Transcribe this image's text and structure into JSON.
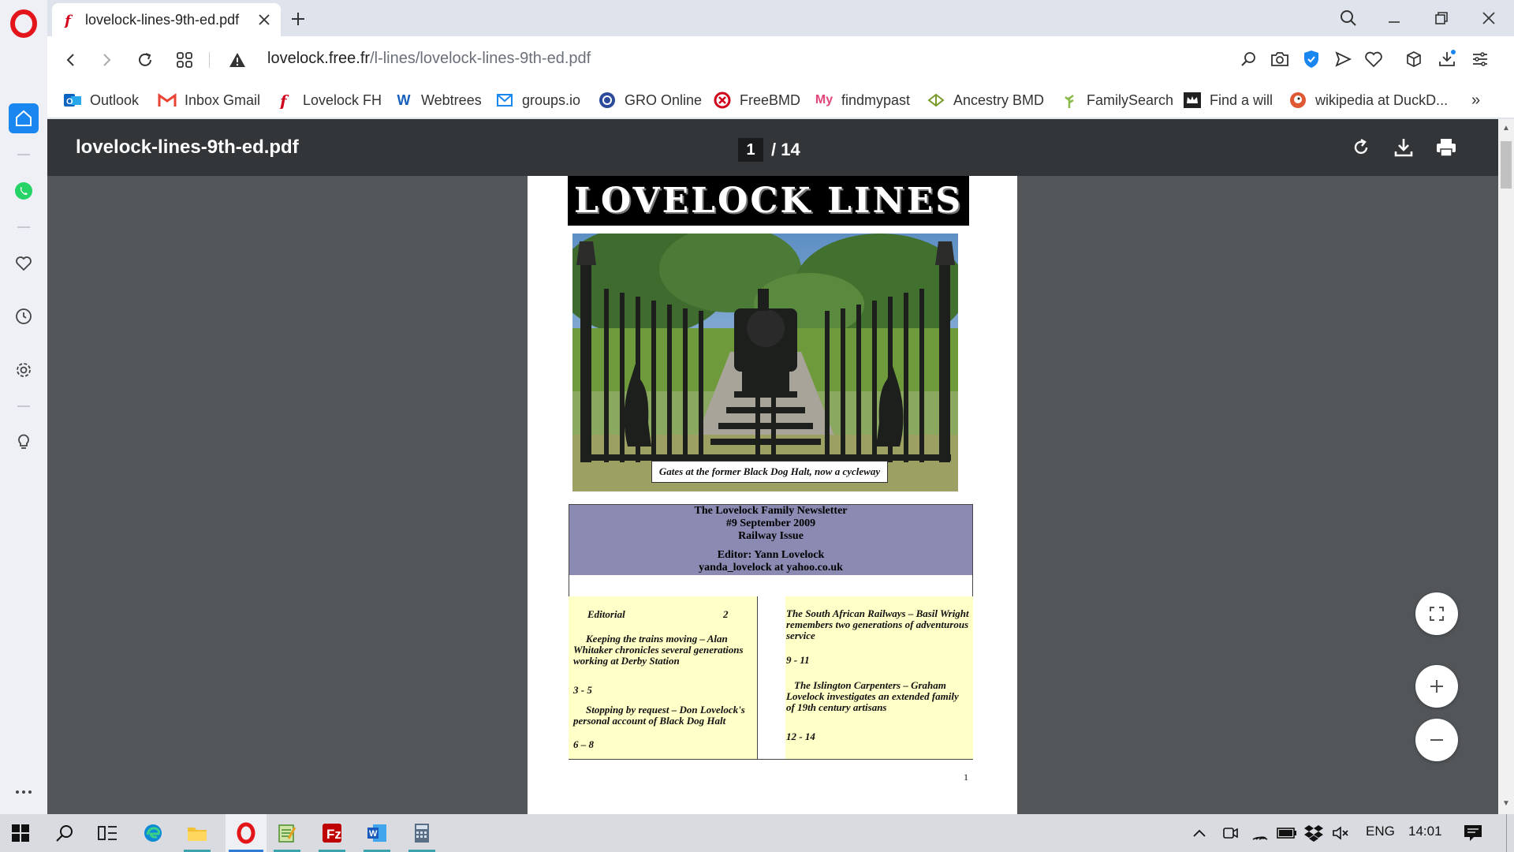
{
  "browser": {
    "tab": {
      "title": "lovelock-lines-9th-ed.pdf",
      "favicon": "free-fr-favicon"
    },
    "address": {
      "host": "lovelock.free.fr",
      "path": "/l-lines/lovelock-lines-9th-ed.pdf",
      "security": "warning-icon"
    },
    "bookmarks": [
      {
        "label": "Outlook",
        "icon": "outlook-icon"
      },
      {
        "label": "Inbox Gmail",
        "icon": "gmail-icon"
      },
      {
        "label": "Lovelock FH",
        "icon": "free-fr-favicon"
      },
      {
        "label": "Webtrees",
        "icon": "webtrees-icon"
      },
      {
        "label": "groups.io",
        "icon": "mail-icon"
      },
      {
        "label": "GRO Online",
        "icon": "gro-icon"
      },
      {
        "label": "FreeBMD",
        "icon": "freebmd-icon"
      },
      {
        "label": "findmypast",
        "icon": "findmypast-icon"
      },
      {
        "label": "Ancestry BMD",
        "icon": "ancestry-icon"
      },
      {
        "label": "FamilySearch",
        "icon": "familysearch-icon"
      },
      {
        "label": "Find a will",
        "icon": "crown-icon"
      },
      {
        "label": "wikipedia at DuckD...",
        "icon": "duckduckgo-icon"
      }
    ],
    "more_bookmarks": "»"
  },
  "pdf": {
    "filename": "lovelock-lines-9th-ed.pdf",
    "current_page": "1",
    "total_pages": "/ 14"
  },
  "document": {
    "masthead": "LOVELOCK LINES",
    "caption": "Gates at the former Black Dog Halt, now a cycleway",
    "newsletter": {
      "line1": "The Lovelock Family Newsletter",
      "line2": "#9  September 2009",
      "line3": "Railway Issue",
      "editor": "Editor: Yann Lovelock",
      "email": "yanda_lovelock at yahoo.co.uk"
    },
    "contents_left": [
      {
        "title": "Editorial",
        "pages": "2"
      },
      {
        "title": "Keeping the trains moving – Alan Whitaker chronicles several generations working at Derby Station",
        "pages": "3 - 5"
      },
      {
        "title": "Stopping by request – Don Lovelock's personal account of Black Dog Halt",
        "pages": "6 – 8"
      }
    ],
    "contents_right": [
      {
        "title": "The South African Railways – Basil Wright remembers two generations of adventurous service",
        "pages": "9 - 11"
      },
      {
        "title": "The Islington Carpenters – Graham Lovelock investigates an extended family of 19th century artisans",
        "pages": "12 - 14"
      }
    ],
    "page_number": "1"
  },
  "taskbar": {
    "language": "ENG",
    "time": "14:01"
  },
  "colors": {
    "accent": "#1a86f0",
    "pdf_toolbar": "#323639",
    "pdf_background": "#525659",
    "newsletter_header": "#8a8ab3",
    "contents_bg": "#ffffc8"
  }
}
